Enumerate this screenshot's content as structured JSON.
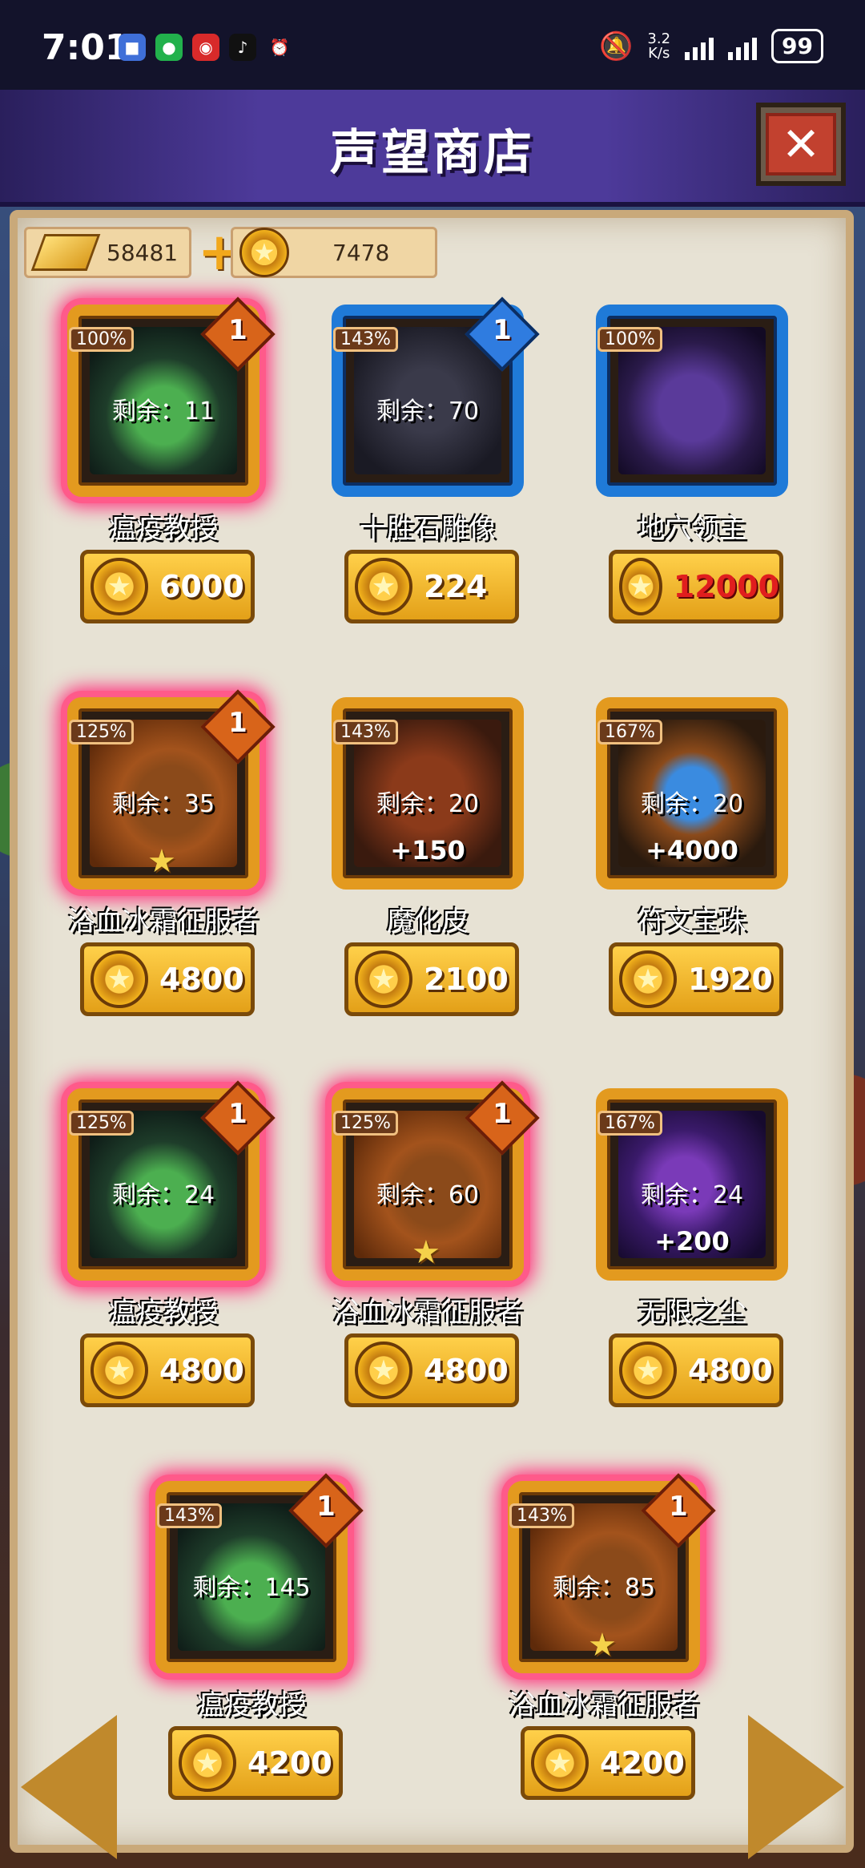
{
  "status": {
    "time": "7:01",
    "speed_value": "3.2",
    "speed_unit": "K/s",
    "battery": "99",
    "notif_icons": [
      "app-icon",
      "wechat-icon",
      "bank-icon",
      "tiktok-icon",
      "alarm-icon"
    ]
  },
  "header": {
    "title": "声望商店"
  },
  "currency": {
    "gold": "58481",
    "coins": "7478"
  },
  "items": [
    {
      "name": "瘟疫教授",
      "percent": "100%",
      "remain": "剩余：11",
      "badge": "1",
      "price": "6000",
      "bonus": "",
      "star": false,
      "rarity": "orange",
      "highlight": true
    },
    {
      "name": "十胜石雕像",
      "percent": "143%",
      "remain": "剩余：70",
      "badge": "1",
      "price": "224",
      "bonus": "",
      "star": false,
      "rarity": "blue",
      "highlight": false
    },
    {
      "name": "地穴领主",
      "percent": "100%",
      "remain": "",
      "badge": "",
      "price": "12000",
      "bonus": "",
      "star": false,
      "rarity": "blue",
      "highlight": false,
      "price_red": true
    },
    {
      "name": "浴血冰霜征服者",
      "percent": "125%",
      "remain": "剩余：35",
      "badge": "1",
      "price": "4800",
      "bonus": "",
      "star": true,
      "rarity": "orange",
      "highlight": true
    },
    {
      "name": "魔化皮",
      "percent": "143%",
      "remain": "剩余：20",
      "badge": "",
      "price": "2100",
      "bonus": "+150",
      "star": false,
      "rarity": "orange",
      "highlight": false
    },
    {
      "name": "符文宝珠",
      "percent": "167%",
      "remain": "剩余：20",
      "badge": "",
      "price": "1920",
      "bonus": "+4000",
      "star": false,
      "rarity": "orange",
      "highlight": false
    },
    {
      "name": "瘟疫教授",
      "percent": "125%",
      "remain": "剩余：24",
      "badge": "1",
      "price": "4800",
      "bonus": "",
      "star": false,
      "rarity": "orange",
      "highlight": true
    },
    {
      "name": "浴血冰霜征服者",
      "percent": "125%",
      "remain": "剩余：60",
      "badge": "1",
      "price": "4800",
      "bonus": "",
      "star": true,
      "rarity": "orange",
      "highlight": true
    },
    {
      "name": "无限之尘",
      "percent": "167%",
      "remain": "剩余：24",
      "badge": "",
      "price": "4800",
      "bonus": "+200",
      "star": false,
      "rarity": "orange",
      "highlight": false
    },
    {
      "name": "瘟疫教授",
      "percent": "143%",
      "remain": "剩余：145",
      "badge": "1",
      "price": "4200",
      "bonus": "",
      "star": false,
      "rarity": "orange",
      "highlight": true
    },
    {
      "name": "浴血冰霜征服者",
      "percent": "143%",
      "remain": "剩余：85",
      "badge": "1",
      "price": "4200",
      "bonus": "",
      "star": true,
      "rarity": "orange",
      "highlight": true
    }
  ],
  "colors": {
    "accent_gold": "#e3a018",
    "price_red": "#e01e1e",
    "highlight_pink": "#ff2a7a"
  }
}
